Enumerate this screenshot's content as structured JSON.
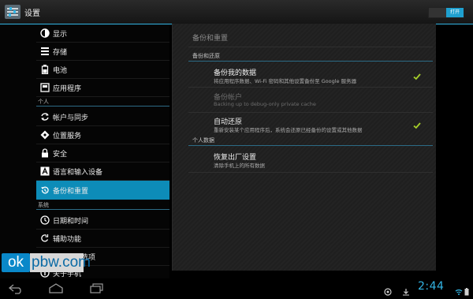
{
  "actionbar": {
    "title": "设置",
    "toggle_label": "打开"
  },
  "sidebar": {
    "items": [
      {
        "label": "显示",
        "icon": "brightness-icon"
      },
      {
        "label": "存储",
        "icon": "storage-icon"
      },
      {
        "label": "电池",
        "icon": "battery-icon"
      },
      {
        "label": "应用程序",
        "icon": "apps-icon"
      },
      {
        "label": "帐户与同步",
        "icon": "sync-icon"
      },
      {
        "label": "位置服务",
        "icon": "location-icon"
      },
      {
        "label": "安全",
        "icon": "lock-icon"
      },
      {
        "label": "语言和输入设备",
        "icon": "language-icon"
      },
      {
        "label": "备份和重置",
        "icon": "backup-icon"
      },
      {
        "label": "日期和时间",
        "icon": "clock-icon"
      },
      {
        "label": "辅助功能",
        "icon": "accessibility-icon"
      },
      {
        "label": "开发人员选项",
        "icon": "developer-icon"
      },
      {
        "label": "关于手机",
        "icon": "info-icon"
      }
    ],
    "sections": {
      "personal": "个人",
      "system": "系统"
    }
  },
  "detail": {
    "title": "备份和重置",
    "section_backup": "备份和还原",
    "backup_data": {
      "title": "备份我的数据",
      "summary": "将应用程序数据、Wi-Fi 密码和其他设置备份至 Google 服务器",
      "checked": true
    },
    "backup_account": {
      "title": "备份帐户",
      "summary": "Backing up to debug-only private cache",
      "enabled": false
    },
    "auto_restore": {
      "title": "自动还原",
      "summary": "重新安装某个应用程序后，系统会还原已经备份的设置或其他数据",
      "checked": true
    },
    "section_personal": "个人数据",
    "factory_reset": {
      "title": "恢复出厂设置",
      "summary": "清除手机上的所有数据"
    }
  },
  "watermark": {
    "part1": "ok",
    "part2": "pbw.com"
  },
  "statusbar": {
    "clock": "2:44"
  },
  "colors": {
    "accent": "#33b5e5",
    "selected": "#0d8cb8",
    "check": "#9acd32"
  }
}
